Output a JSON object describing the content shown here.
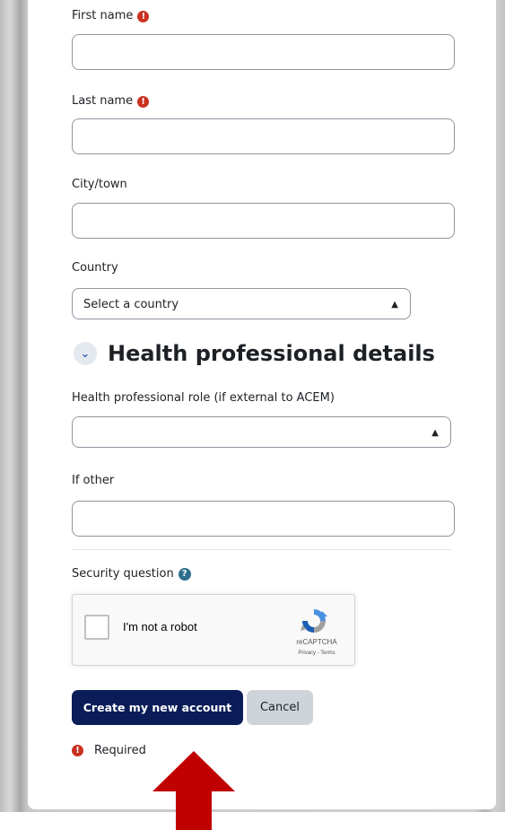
{
  "form": {
    "first_name": {
      "label": "First name",
      "value": ""
    },
    "last_name": {
      "label": "Last name",
      "value": ""
    },
    "city": {
      "label": "City/town",
      "value": ""
    },
    "country": {
      "label": "Country",
      "selected": "Select a country"
    },
    "section": {
      "title": "Health professional details"
    },
    "hp_role": {
      "label": "Health professional role (if external to ACEM)",
      "selected": ""
    },
    "if_other": {
      "label": "If other",
      "value": ""
    },
    "security": {
      "label": "Security question"
    }
  },
  "recaptcha": {
    "checkbox_label": "I'm not a robot",
    "brand": "reCAPTCHA",
    "links": "Privacy - Terms"
  },
  "buttons": {
    "submit": "Create my new account",
    "cancel": "Cancel"
  },
  "required_note": "Required",
  "icons": {
    "required": "exclamation-circle-icon",
    "help": "question-circle-icon",
    "section_toggle": "chevron-down-icon",
    "select_caret": "sort-caret-icon",
    "annotation": "red-arrow-up"
  },
  "colors": {
    "primary_button": "#0b1d58",
    "required_icon": "#ca3120",
    "help_icon": "#2e6f8e",
    "arrow": "#c00000"
  }
}
